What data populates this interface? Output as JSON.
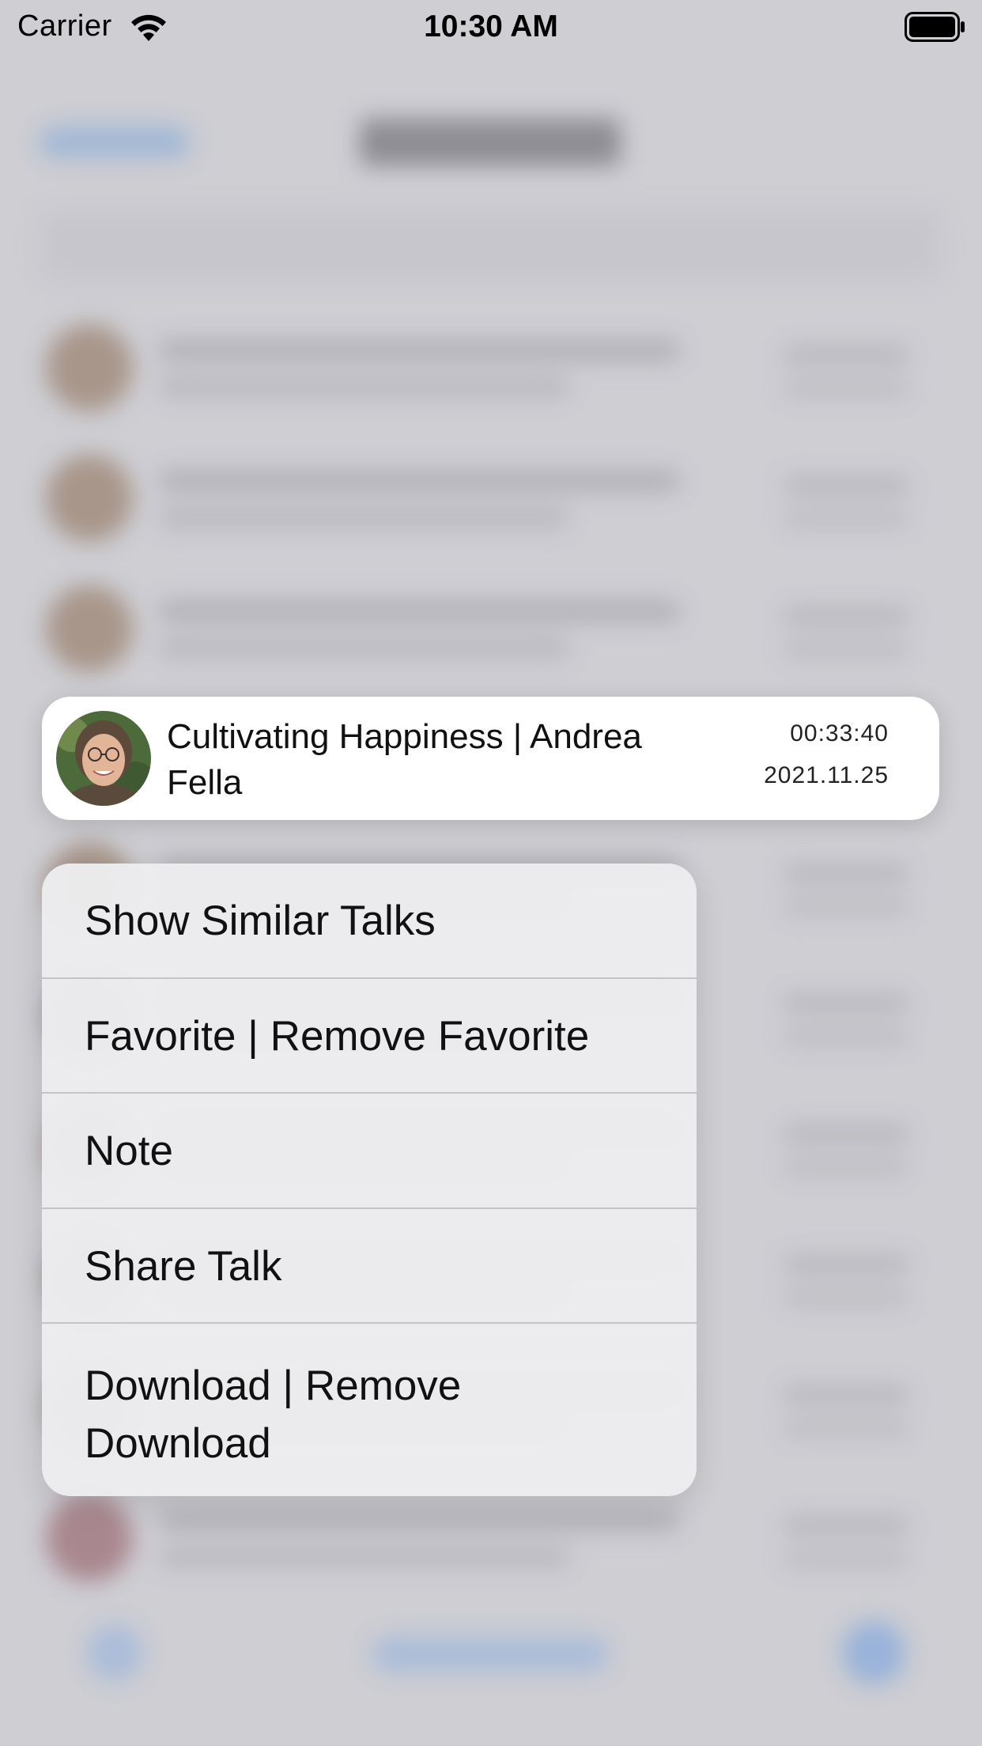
{
  "status_bar": {
    "carrier": "Carrier",
    "time": "10:30 AM",
    "wifi_icon": "wifi-icon",
    "battery_icon": "battery-full-icon"
  },
  "preview": {
    "title": "Cultivating Happiness | Andrea Fella",
    "duration": "00:33:40",
    "date": "2021.11.25"
  },
  "menu": {
    "items": [
      {
        "label": "Show Similar Talks"
      },
      {
        "label": "Favorite | Remove Favorite"
      },
      {
        "label": "Note"
      },
      {
        "label": "Share Talk"
      },
      {
        "label": "Download | Remove Download"
      }
    ]
  },
  "colors": {
    "background_dim": "#cfcfd3",
    "card": "#ffffff",
    "menu": "#ececee",
    "separator": "#c4c4c8",
    "accent": "#6f9ee0"
  }
}
